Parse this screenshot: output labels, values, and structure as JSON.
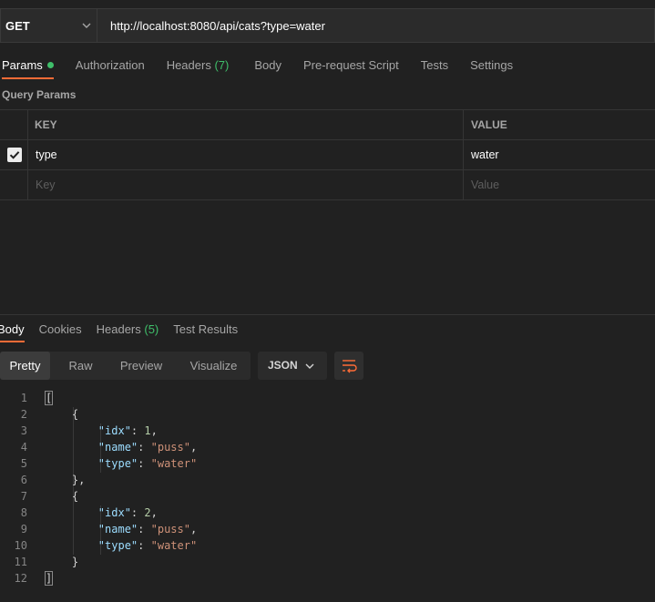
{
  "request": {
    "method": "GET",
    "url": "http://localhost:8080/api/cats?type=water"
  },
  "request_tabs": {
    "params": "Params",
    "authorization": "Authorization",
    "headers": "Headers",
    "headers_count": "(7)",
    "body": "Body",
    "pre_request_script": "Pre-request Script",
    "tests": "Tests",
    "settings": "Settings"
  },
  "query_params": {
    "title": "Query Params",
    "col_key": "KEY",
    "col_value": "VALUE",
    "rows": [
      {
        "checked": true,
        "key": "type",
        "value": "water"
      }
    ],
    "placeholder_key": "Key",
    "placeholder_value": "Value"
  },
  "response_tabs": {
    "body": "Body",
    "cookies": "Cookies",
    "headers": "Headers",
    "headers_count": "(5)",
    "test_results": "Test Results"
  },
  "view_modes": {
    "pretty": "Pretty",
    "raw": "Raw",
    "preview": "Preview",
    "visualize": "Visualize"
  },
  "format": "JSON",
  "code_lines": {
    "n1": "1",
    "n2": "2",
    "n3": "3",
    "n4": "4",
    "n5": "5",
    "n6": "6",
    "n7": "7",
    "n8": "8",
    "n9": "9",
    "n10": "10",
    "n11": "11",
    "n12": "12"
  },
  "response_json": [
    {
      "idx": "1",
      "name": "puss",
      "type": "water"
    },
    {
      "idx": "2",
      "name": "puss",
      "type": "water"
    }
  ],
  "json_tokens": {
    "open_array": "[",
    "close_array": "]",
    "open_obj": "{",
    "close_obj_comma": "},",
    "close_obj": "}",
    "key_idx": "\"idx\"",
    "key_name": "\"name\"",
    "key_type": "\"type\"",
    "colon": ": ",
    "comma": ","
  },
  "colors": {
    "accent": "#ff6c37",
    "count_green": "#3fbf6a",
    "json_key": "#9cdcfe",
    "json_string": "#ce9178",
    "json_number": "#b5cea8"
  },
  "icons": {
    "method_dropdown": "chevron-down-icon",
    "format_dropdown": "chevron-down-icon",
    "wrap": "wrap-lines-icon",
    "checkbox": "checkmark-icon"
  }
}
